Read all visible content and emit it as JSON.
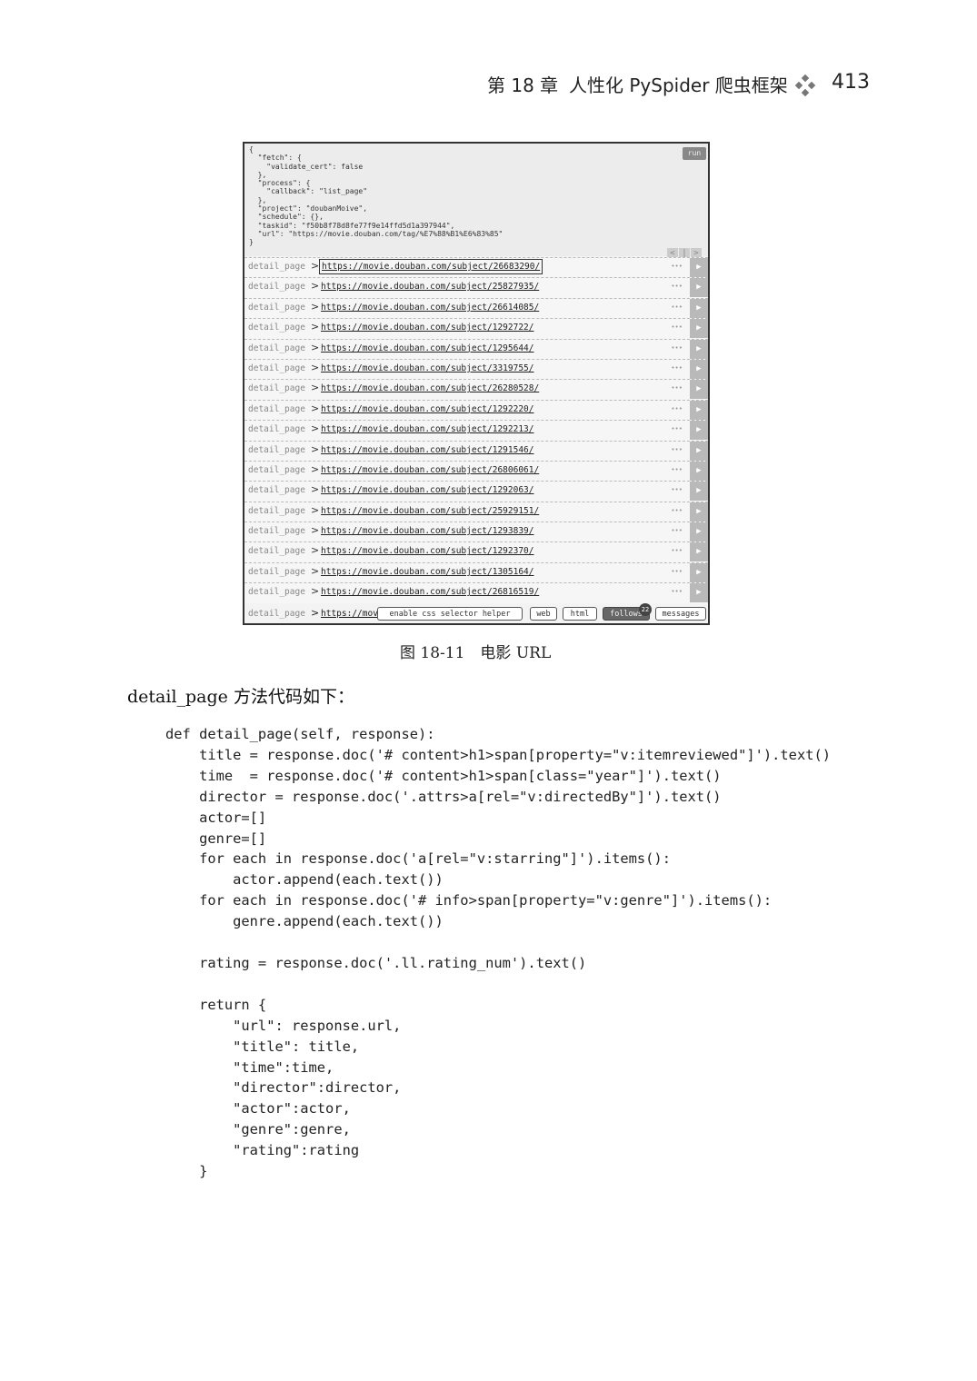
{
  "header": {
    "chapter": "第 18 章",
    "title": "人性化 PySpider 爬虫框架",
    "page_number": "413"
  },
  "screenshot": {
    "json_text": "{\n  \"fetch\": {\n    \"validate_cert\": false\n  },\n  \"process\": {\n    \"callback\": \"list_page\"\n  },\n  \"project\": \"doubanMoive\",\n  \"schedule\": {},\n  \"taskid\": \"f50b8f78d8fe77f9e14ffd5d1a397944\",\n  \"url\": \"https://movie.douban.com/tag/%E7%88%B1%E6%83%85\"\n}",
    "run_button": "run",
    "pager": [
      "<",
      "|",
      ">"
    ],
    "callback_label": "detail_page",
    "arrow": ">",
    "row_dots": "•••",
    "play_icon": "▶",
    "rows": [
      "https://movie.douban.com/subject/26683290/",
      "https://movie.douban.com/subject/25827935/",
      "https://movie.douban.com/subject/26614085/",
      "https://movie.douban.com/subject/1292722/",
      "https://movie.douban.com/subject/1295644/",
      "https://movie.douban.com/subject/3319755/",
      "https://movie.douban.com/subject/26280528/",
      "https://movie.douban.com/subject/1292220/",
      "https://movie.douban.com/subject/1292213/",
      "https://movie.douban.com/subject/1291546/",
      "https://movie.douban.com/subject/26806061/",
      "https://movie.douban.com/subject/1292063/",
      "https://movie.douban.com/subject/25929151/",
      "https://movie.douban.com/subject/1293839/",
      "https://movie.douban.com/subject/1292370/",
      "https://movie.douban.com/subject/1305164/",
      "https://movie.douban.com/subject/26816519/"
    ],
    "last_row_partial": "https://mov",
    "toolbar": {
      "css_helper": "enable css selector helper",
      "web": "web",
      "html": "html",
      "follows": "follows",
      "follows_count": "22",
      "messages": "messages"
    }
  },
  "caption": "图 18-11　电影 URL",
  "paragraph": "detail_page 方法代码如下：",
  "code": "def detail_page(self, response):\n    title = response.doc('# content>h1>span[property=\"v:itemreviewed\"]').text()\n    time  = response.doc('# content>h1>span[class=\"year\"]').text()\n    director = response.doc('.attrs>a[rel=\"v:directedBy\"]').text()\n    actor=[]\n    genre=[]\n    for each in response.doc('a[rel=\"v:starring\"]').items():\n        actor.append(each.text())\n    for each in response.doc('# info>span[property=\"v:genre\"]').items():\n        genre.append(each.text())\n\n    rating = response.doc('.ll.rating_num').text()\n\n    return {\n        \"url\": response.url,\n        \"title\": title,\n        \"time\":time,\n        \"director\":director,\n        \"actor\":actor,\n        \"genre\":genre,\n        \"rating\":rating\n    }"
}
